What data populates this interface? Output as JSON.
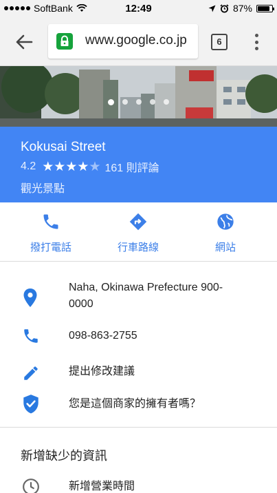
{
  "status_bar": {
    "carrier": "SoftBank",
    "time": "12:49",
    "battery": "87%",
    "battery_level": 0.87
  },
  "browser": {
    "url_dim": "",
    "url": "www.google.co.jp",
    "tab_count": "6"
  },
  "photo": {
    "carousel_count": 5,
    "active_index": 0
  },
  "place": {
    "name": "Kokusai Street",
    "rating": "4.2",
    "rating_value": 4.2,
    "reviews": "161 則評論",
    "category": "觀光景點"
  },
  "actions": {
    "call": "撥打電話",
    "directions": "行車路線",
    "website": "網站"
  },
  "info": {
    "address": "Naha, Okinawa Prefecture 900-0000",
    "address_line1": "Naha, Okinawa Prefecture 900-",
    "address_line2": "0000",
    "phone": "098-863-2755",
    "suggest_edit": "提出修改建議",
    "own_business": "您是這個商家的擁有者嗎？"
  },
  "missing": {
    "title": "新增缺少的資訊",
    "add_hours": "新增營業時間"
  },
  "colors": {
    "header_blue": "#4285f4",
    "accent_blue": "#3c7fe8",
    "icon_blue": "#2979e0",
    "lock_green": "#16a33c"
  }
}
